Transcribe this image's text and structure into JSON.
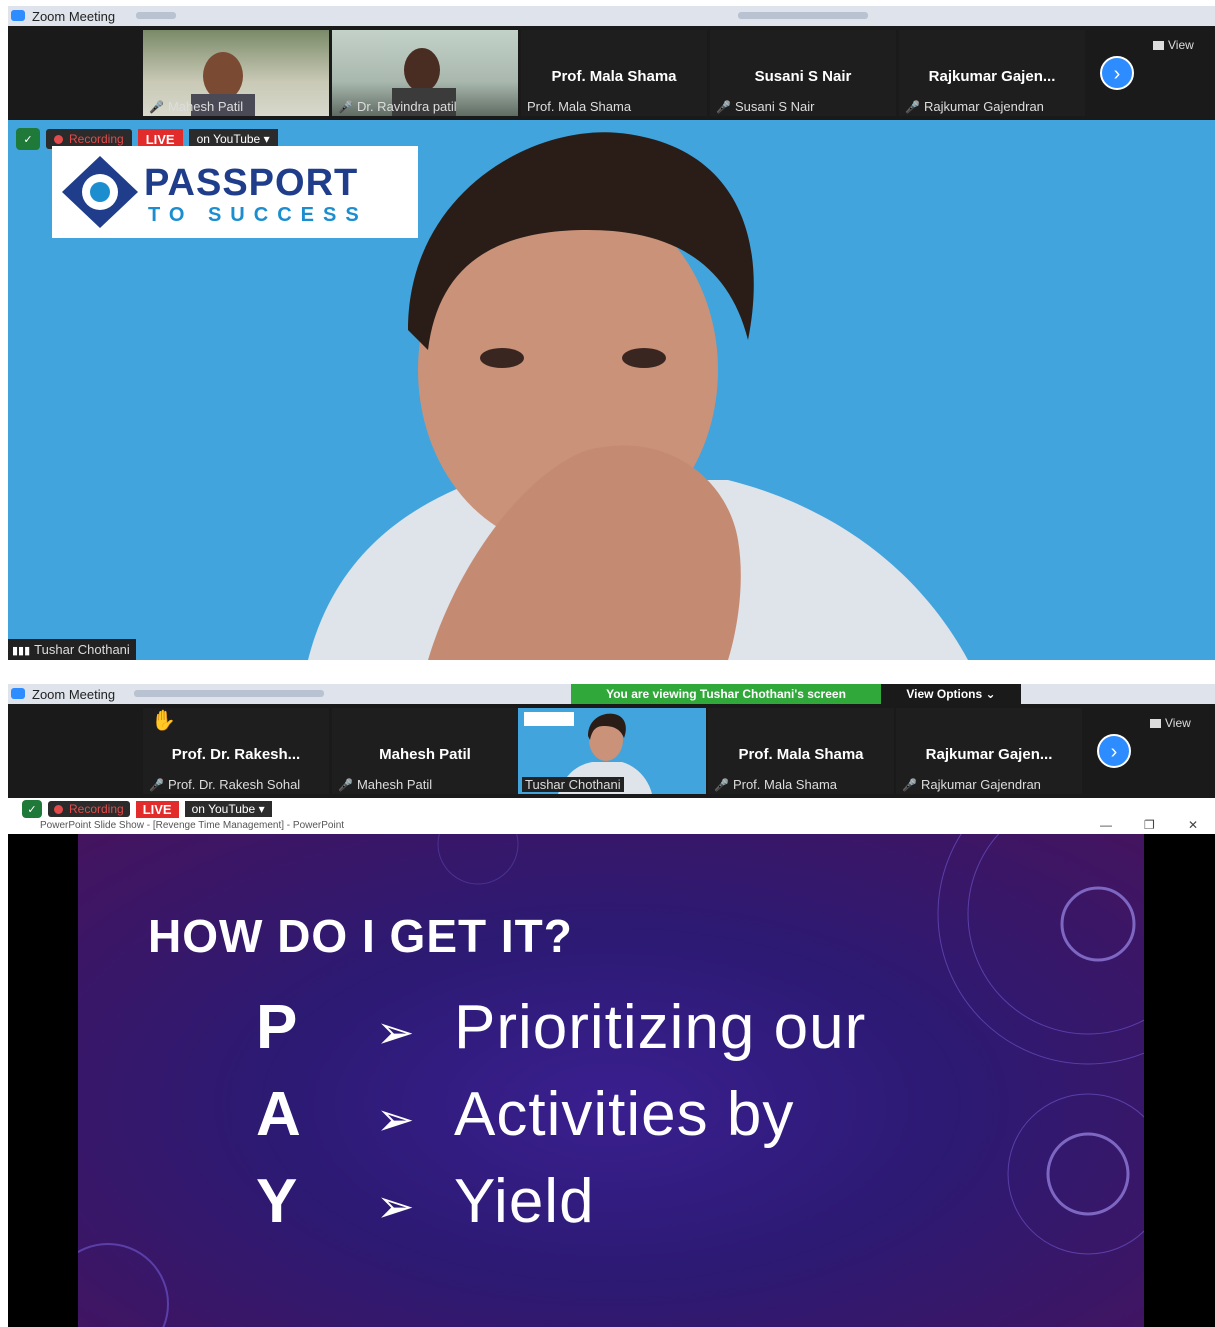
{
  "window1": {
    "title": "Zoom Meeting",
    "strip": {
      "tiles": [
        {
          "name": "Mahesh Patil"
        },
        {
          "name": "Dr. Ravindra patil"
        },
        {
          "center_name": "Prof. Mala Shama",
          "name": "Prof. Mala Shama"
        },
        {
          "center_name": "Susani S Nair",
          "name": "Susani S Nair"
        },
        {
          "center_name": "Rajkumar  Gajen...",
          "name": "Rajkumar Gajendran"
        }
      ],
      "view_label": "View"
    },
    "recording_label": "Recording",
    "live_label": "LIVE",
    "youtube_label": "on YouTube",
    "logo": {
      "line1": "PASSPORT",
      "line2": "TO SUCCESS"
    },
    "speaker_name": "Tushar Chothani"
  },
  "window2": {
    "title": "Zoom Meeting",
    "banner": "You are viewing Tushar Chothani's screen",
    "view_options": "View Options",
    "strip": {
      "tiles": [
        {
          "center_name": "Prof. Dr. Rakesh...",
          "name": "Prof. Dr. Rakesh Sohal"
        },
        {
          "center_name": "Mahesh Patil",
          "name": "Mahesh Patil"
        },
        {
          "name": "Tushar Chothani"
        },
        {
          "center_name": "Prof. Mala Shama",
          "name": "Prof. Mala Shama"
        },
        {
          "center_name": "Rajkumar  Gajen...",
          "name": "Rajkumar Gajendran"
        }
      ],
      "view_label": "View"
    },
    "recording_label": "Recording",
    "live_label": "LIVE",
    "youtube_label": "on YouTube",
    "ppt_title": "PowerPoint Slide Show - [Revenge Time Management] - PowerPoint",
    "slide": {
      "heading": "HOW DO I GET IT?",
      "rows": [
        {
          "letter": "P",
          "text": "Prioritizing our"
        },
        {
          "letter": "A",
          "text": "Activities by"
        },
        {
          "letter": "Y",
          "text": "Yield"
        }
      ]
    }
  },
  "colors": {
    "zoom_blue": "#2d8cff",
    "live_red": "#e22b2b",
    "banner_green": "#31a83a",
    "video_bg_blue": "#41a4dc",
    "slide_purple": "#2c1a73"
  }
}
